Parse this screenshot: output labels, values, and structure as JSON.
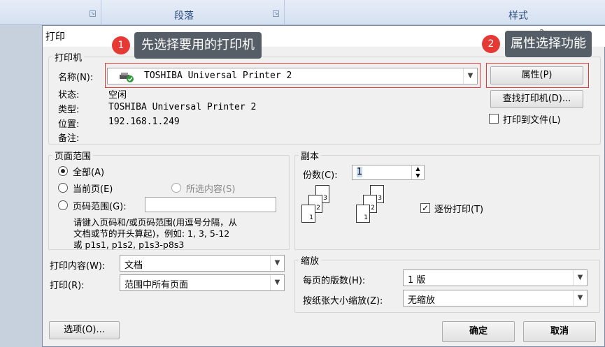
{
  "ribbon": {
    "paragraph": "段落",
    "styles": "样式"
  },
  "dialog": {
    "title": "打印",
    "help": "?",
    "printer_group": {
      "legend": "打印机",
      "name_label": "名称(N):",
      "name_value": "TOSHIBA Universal Printer 2",
      "status_label": "状态:",
      "status_value": "空闲",
      "type_label": "类型:",
      "type_value": "TOSHIBA Universal Printer 2",
      "location_label": "位置:",
      "location_value": "192.168.1.249",
      "comment_label": "备注:",
      "properties_button": "属性(P)",
      "find_printer_button": "查找打印机(D)...",
      "print_to_file_label": "打印到文件(L)",
      "print_to_file_checked": false
    },
    "page_range": {
      "legend": "页面范围",
      "all": "全部(A)",
      "current": "当前页(E)",
      "selection": "所选内容(S)",
      "pages": "页码范围(G):",
      "pages_value": "",
      "selected": "all",
      "hint_line1": "请键入页码和/或页码范围(用逗号分隔，从",
      "hint_line2": "文档或节的开头算起)，例如: 1, 3, 5-12",
      "hint_line3": "或 p1s1, p1s2, p1s3-p8s3"
    },
    "copies": {
      "legend": "副本",
      "count_label": "份数(C):",
      "count_value": "1",
      "collate_label": "逐份打印(T)",
      "collate_checked": true,
      "collate_numbers": [
        "1",
        "2",
        "3"
      ]
    },
    "print_what_label": "打印内容(W):",
    "print_what_value": "文档",
    "print_label": "打印(R):",
    "print_value": "范围中所有页面",
    "zoom": {
      "legend": "缩放",
      "pages_per_sheet_label": "每页的版数(H):",
      "pages_per_sheet_value": "1 版",
      "scale_label": "按纸张大小缩放(Z):",
      "scale_value": "无缩放"
    },
    "options_button": "选项(O)...",
    "ok_button": "确定",
    "cancel_button": "取消"
  },
  "annotations": {
    "step1_number": "1",
    "step1_text": "先选择要用的打印机",
    "step2_number": "2",
    "step2_text": "属性选择功能",
    "highlight_color": "#e53935"
  }
}
